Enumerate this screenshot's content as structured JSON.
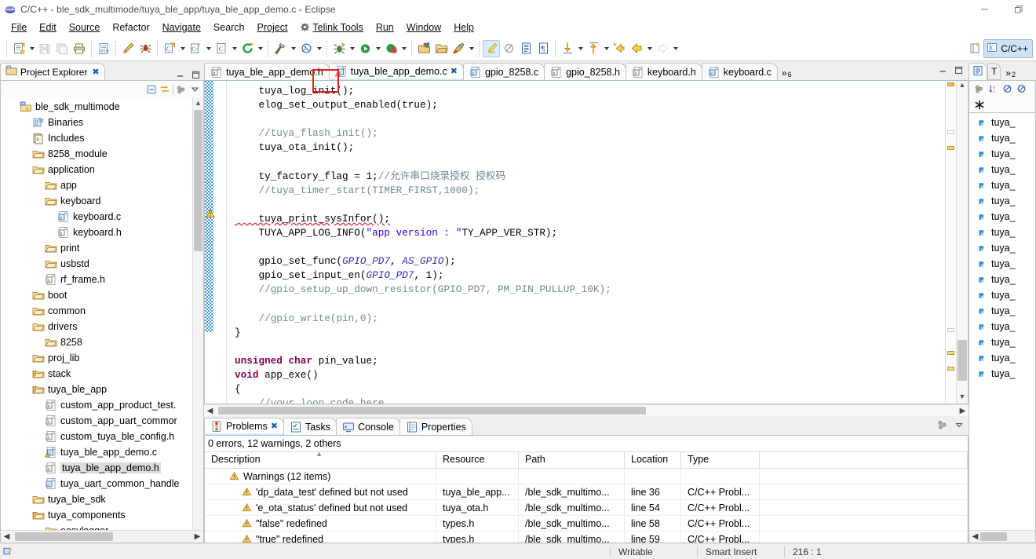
{
  "window": {
    "title": "C/C++ - ble_sdk_multimode/tuya_ble_app/tuya_ble_app_demo.c - Eclipse",
    "minimize_label": "—",
    "maximize_label": "❐"
  },
  "menubar": {
    "items": [
      {
        "label": "File",
        "mnemonic": "F"
      },
      {
        "label": "Edit",
        "mnemonic": "E"
      },
      {
        "label": "Source",
        "mnemonic": "S"
      },
      {
        "label": "Refactor",
        "mnemonic": "t"
      },
      {
        "label": "Navigate",
        "mnemonic": "N"
      },
      {
        "label": "Search",
        "mnemonic": "a"
      },
      {
        "label": "Project",
        "mnemonic": "P"
      },
      {
        "label": "Telink Tools",
        "mnemonic": "T",
        "icon": "telink-gear-icon"
      },
      {
        "label": "Run",
        "mnemonic": "R"
      },
      {
        "label": "Window",
        "mnemonic": "W"
      },
      {
        "label": "Help",
        "mnemonic": "H"
      }
    ]
  },
  "toolbar": {
    "groups": [
      {
        "buttons": [
          {
            "name": "new-wizard",
            "icon": "new-file-icon",
            "dropdown": true
          },
          {
            "name": "save",
            "icon": "save-icon",
            "dropdown": false,
            "disabled": true
          },
          {
            "name": "save-all",
            "icon": "save-all-icon",
            "dropdown": false,
            "disabled": true
          },
          {
            "name": "print",
            "icon": "print-icon",
            "dropdown": false
          }
        ]
      },
      {
        "buttons": [
          {
            "name": "toggle-binary",
            "icon": "binary-icon",
            "dropdown": false
          }
        ]
      },
      {
        "buttons": [
          {
            "name": "new-c-c++-source",
            "icon": "pencil-icon",
            "dropdown": false
          },
          {
            "name": "new-c-c++-class",
            "icon": "spider-icon",
            "dropdown": false
          }
        ]
      },
      {
        "buttons": [
          {
            "name": "new-c-project",
            "icon": "c-project-icon",
            "dropdown": true
          },
          {
            "name": "new-cpp-project",
            "icon": "cpp-project-icon",
            "dropdown": true
          },
          {
            "name": "new-c-file",
            "icon": "c-file-icon",
            "dropdown": true
          },
          {
            "name": "refresh",
            "icon": "refresh-green-icon",
            "dropdown": true
          }
        ]
      },
      {
        "buttons": [
          {
            "name": "build",
            "icon": "hammer-icon",
            "dropdown": true,
            "highlighted": true
          },
          {
            "name": "clean",
            "icon": "broom-icon",
            "dropdown": true
          }
        ]
      },
      {
        "buttons": [
          {
            "name": "debug",
            "icon": "bug-icon",
            "dropdown": true
          },
          {
            "name": "run",
            "icon": "run-green-icon",
            "dropdown": true
          },
          {
            "name": "profile",
            "icon": "profile-icon",
            "dropdown": true
          }
        ]
      },
      {
        "buttons": [
          {
            "name": "open-resource",
            "icon": "open-type-icon",
            "dropdown": false
          },
          {
            "name": "open-element",
            "icon": "open-folder-icon",
            "dropdown": false
          },
          {
            "name": "skip-breakpoints",
            "icon": "rocket-icon",
            "dropdown": true
          }
        ]
      },
      {
        "buttons": [
          {
            "name": "toggle-mark-occurrences",
            "icon": "marker-pen-icon",
            "dropdown": false,
            "selected": true
          },
          {
            "name": "toggle-block-selection",
            "icon": "block-select-icon",
            "dropdown": false
          },
          {
            "name": "show-whitespace",
            "icon": "whitespace-icon",
            "dropdown": false
          },
          {
            "name": "show-pilcrow",
            "icon": "pilcrow-icon",
            "dropdown": false
          }
        ]
      },
      {
        "buttons": [
          {
            "name": "next-annotation",
            "icon": "next-annotation-icon",
            "dropdown": true
          },
          {
            "name": "previous-annotation",
            "icon": "prev-annotation-icon",
            "dropdown": true
          },
          {
            "name": "last-edit-location",
            "icon": "last-edit-icon",
            "dropdown": false
          },
          {
            "name": "back",
            "icon": "back-arrow-icon",
            "dropdown": true
          },
          {
            "name": "forward",
            "icon": "forward-arrow-icon",
            "dropdown": true,
            "disabled": true
          }
        ]
      }
    ],
    "perspective": {
      "open_perspective_tooltip": "Open Perspective",
      "current_label": "C/C++"
    }
  },
  "project_explorer": {
    "tab_label": "Project Explorer",
    "close_glyph": "✖",
    "toolbar": [
      {
        "name": "collapse-all-icon"
      },
      {
        "name": "link-with-editor-icon"
      },
      {
        "name": "view-menu-icon"
      },
      {
        "name": "view-dropdown-icon"
      }
    ],
    "tree": [
      {
        "label": "ble_sdk_multimode",
        "indent": 1,
        "icon": "c-project-icon"
      },
      {
        "label": "Binaries",
        "indent": 2,
        "icon": "binaries-icon"
      },
      {
        "label": "Includes",
        "indent": 2,
        "icon": "includes-icon"
      },
      {
        "label": "8258_module",
        "indent": 2,
        "icon": "folder-icon"
      },
      {
        "label": "application",
        "indent": 2,
        "icon": "folder-icon"
      },
      {
        "label": "app",
        "indent": 3,
        "icon": "folder-icon"
      },
      {
        "label": "keyboard",
        "indent": 3,
        "icon": "folder-icon"
      },
      {
        "label": "keyboard.c",
        "indent": 4,
        "icon": "c-file-icon"
      },
      {
        "label": "keyboard.h",
        "indent": 4,
        "icon": "h-file-icon"
      },
      {
        "label": "print",
        "indent": 3,
        "icon": "folder-icon"
      },
      {
        "label": "usbstd",
        "indent": 3,
        "icon": "folder-icon"
      },
      {
        "label": "rf_frame.h",
        "indent": 3,
        "icon": "h-file-icon"
      },
      {
        "label": "boot",
        "indent": 2,
        "icon": "folder-icon"
      },
      {
        "label": "common",
        "indent": 2,
        "icon": "folder-icon"
      },
      {
        "label": "drivers",
        "indent": 2,
        "icon": "folder-icon"
      },
      {
        "label": "8258",
        "indent": 3,
        "icon": "folder-icon"
      },
      {
        "label": "proj_lib",
        "indent": 2,
        "icon": "folder-icon"
      },
      {
        "label": "stack",
        "indent": 2,
        "icon": "folder-src-icon"
      },
      {
        "label": "tuya_ble_app",
        "indent": 2,
        "icon": "folder-src-icon"
      },
      {
        "label": "custom_app_product_test.",
        "indent": 3,
        "icon": "h-file-icon"
      },
      {
        "label": "custom_app_uart_commor",
        "indent": 3,
        "icon": "h-file-icon"
      },
      {
        "label": "custom_tuya_ble_config.h",
        "indent": 3,
        "icon": "h-file-icon"
      },
      {
        "label": "tuya_ble_app_demo.c",
        "indent": 3,
        "icon": "c-file-warn-icon"
      },
      {
        "label": "tuya_ble_app_demo.h",
        "indent": 3,
        "icon": "h-file-icon",
        "selected": true
      },
      {
        "label": "tuya_uart_common_handle",
        "indent": 3,
        "icon": "c-file-icon"
      },
      {
        "label": "tuya_ble_sdk",
        "indent": 2,
        "icon": "folder-icon"
      },
      {
        "label": "tuya_components",
        "indent": 2,
        "icon": "folder-src-icon"
      },
      {
        "label": "easylogger",
        "indent": 3,
        "icon": "folder-icon"
      }
    ]
  },
  "editor": {
    "tabs": [
      {
        "label": "tuya_ble_app_demo.h",
        "icon": "h-file-icon",
        "active": false,
        "closable": false
      },
      {
        "label": "tuya_ble_app_demo.c",
        "icon": "c-file-warn-icon",
        "active": true,
        "closable": true
      },
      {
        "label": "gpio_8258.c",
        "icon": "c-file-icon",
        "active": false,
        "closable": false
      },
      {
        "label": "gpio_8258.h",
        "icon": "h-file-icon",
        "active": false,
        "closable": false
      },
      {
        "label": "keyboard.h",
        "icon": "h-file-icon",
        "active": false,
        "closable": false
      },
      {
        "label": "keyboard.c",
        "icon": "c-file-icon",
        "active": false,
        "closable": false
      }
    ],
    "more_tabs_glyph": "»",
    "more_tabs_count": "6",
    "minimize_glyph": "—",
    "maximize_glyph": "❐",
    "code_lines": [
      [
        {
          "t": "    tuya_log_init();",
          "c": ""
        }
      ],
      [
        {
          "t": "    elog_set_output_enabled(true);",
          "c": ""
        }
      ],
      [
        {
          "t": "",
          "c": ""
        }
      ],
      [
        {
          "t": "    ",
          "c": ""
        },
        {
          "t": "//tuya_flash_init();",
          "c": "cm"
        }
      ],
      [
        {
          "t": "    tuya_ota_init();",
          "c": ""
        }
      ],
      [
        {
          "t": "",
          "c": ""
        }
      ],
      [
        {
          "t": "    ty_factory_flag = 1;",
          "c": ""
        },
        {
          "t": "//允许串口烧录授权 授权码",
          "c": "cm"
        }
      ],
      [
        {
          "t": "    ",
          "c": ""
        },
        {
          "t": "//tuya_timer_start(TIMER_FIRST,1000);",
          "c": "cm"
        }
      ],
      [
        {
          "t": "",
          "c": ""
        }
      ],
      [
        {
          "t": "    tuya_print_sysInfor();",
          "c": "sq"
        }
      ],
      [
        {
          "t": "    TUYA_APP_LOG_INFO(",
          "c": ""
        },
        {
          "t": "\"app version : \"",
          "c": "str"
        },
        {
          "t": "TY_APP_VER_STR);",
          "c": ""
        }
      ],
      [
        {
          "t": "",
          "c": ""
        }
      ],
      [
        {
          "t": "    gpio_set_func(",
          "c": ""
        },
        {
          "t": "GPIO_PD7",
          "c": "fld"
        },
        {
          "t": ", ",
          "c": ""
        },
        {
          "t": "AS_GPIO",
          "c": "fld"
        },
        {
          "t": ");",
          "c": ""
        }
      ],
      [
        {
          "t": "    gpio_set_input_en(",
          "c": ""
        },
        {
          "t": "GPIO_PD7",
          "c": "fld"
        },
        {
          "t": ", 1);",
          "c": ""
        }
      ],
      [
        {
          "t": "    ",
          "c": ""
        },
        {
          "t": "//gpio_setup_up_down_resistor(GPIO_PD7, PM_PIN_PULLUP_10K);",
          "c": "cm"
        }
      ],
      [
        {
          "t": "",
          "c": ""
        }
      ],
      [
        {
          "t": "    ",
          "c": ""
        },
        {
          "t": "//gpio_write(pin,0);",
          "c": "cm"
        }
      ],
      [
        {
          "t": "}",
          "c": ""
        }
      ],
      [
        {
          "t": "",
          "c": ""
        }
      ],
      [
        {
          "t": "unsigned char",
          "c": "k"
        },
        {
          "t": " pin_value;",
          "c": ""
        }
      ],
      [
        {
          "t": "void",
          "c": "k"
        },
        {
          "t": " app_exe()",
          "c": ""
        }
      ],
      [
        {
          "t": "{",
          "c": ""
        }
      ],
      [
        {
          "t": "    ",
          "c": ""
        },
        {
          "t": "//your loop code here",
          "c": "cm"
        }
      ]
    ]
  },
  "problems_view": {
    "tabs": [
      {
        "label": "Problems",
        "icon": "problems-icon",
        "active": true,
        "closable": true
      },
      {
        "label": "Tasks",
        "icon": "tasks-icon",
        "active": false,
        "closable": false
      },
      {
        "label": "Console",
        "icon": "console-icon",
        "active": false,
        "closable": false
      },
      {
        "label": "Properties",
        "icon": "properties-icon",
        "active": false,
        "closable": false
      }
    ],
    "summary": "0 errors, 12 warnings, 2 others",
    "columns": [
      "Description",
      "Resource",
      "Path",
      "Location",
      "Type"
    ],
    "rows": [
      {
        "icon": "warning-icon",
        "indent": 1,
        "description": "Warnings (12 items)",
        "resource": "",
        "path": "",
        "location": "",
        "type": ""
      },
      {
        "icon": "warning-icon",
        "indent": 2,
        "description": "'dp_data_test' defined but not used",
        "resource": "tuya_ble_app...",
        "path": "/ble_sdk_multimo...",
        "location": "line 36",
        "type": "C/C++ Probl..."
      },
      {
        "icon": "warning-icon",
        "indent": 2,
        "description": "'e_ota_status' defined but not used",
        "resource": "tuya_ota.h",
        "path": "/ble_sdk_multimo...",
        "location": "line 54",
        "type": "C/C++ Probl..."
      },
      {
        "icon": "warning-icon",
        "indent": 2,
        "description": "\"false\" redefined",
        "resource": "types.h",
        "path": "/ble_sdk_multimo...",
        "location": "line 58",
        "type": "C/C++ Probl..."
      },
      {
        "icon": "warning-icon",
        "indent": 2,
        "description": "\"true\" redefined",
        "resource": "types.h",
        "path": "/ble_sdk_multimo...",
        "location": "line 59",
        "type": "C/C++ Probl..."
      }
    ]
  },
  "outline_view": {
    "tabs": [
      {
        "label": "",
        "icon": "outline-icon",
        "active": true
      },
      {
        "label": "T",
        "icon": "type-hierarchy-icon",
        "active": false
      }
    ],
    "more_glyph": "»",
    "more_count": "2",
    "toolbar": [
      {
        "name": "hide-fields-icon"
      },
      {
        "name": "sort-az-icon"
      },
      {
        "name": "hide-non-public-icon"
      },
      {
        "name": "hide-static-icon"
      },
      {
        "name": "hide-macros-icon"
      }
    ],
    "items": [
      "tuya_",
      "tuya_",
      "tuya_",
      "tuya_",
      "tuya_",
      "tuya_",
      "tuya_",
      "tuya_",
      "tuya_",
      "tuya_",
      "tuya_",
      "tuya_",
      "tuya_",
      "tuya_",
      "tuya_",
      "tuya_",
      "tuya_"
    ]
  },
  "statusbar": {
    "writable": "Writable",
    "insert_mode": "Smart Insert",
    "cursor_position": "216 : 1"
  },
  "colors": {
    "accent": "#2f6fad",
    "warning": "#e8a33d",
    "highlight_box": "#e02020",
    "selected_tab_bg": "#ffffff",
    "tab_active_underline": "#d9eaf7",
    "keyword": "#7f0055",
    "comment": "#6d8a95",
    "string": "#2a00ff",
    "field": "#2f2fb8"
  }
}
